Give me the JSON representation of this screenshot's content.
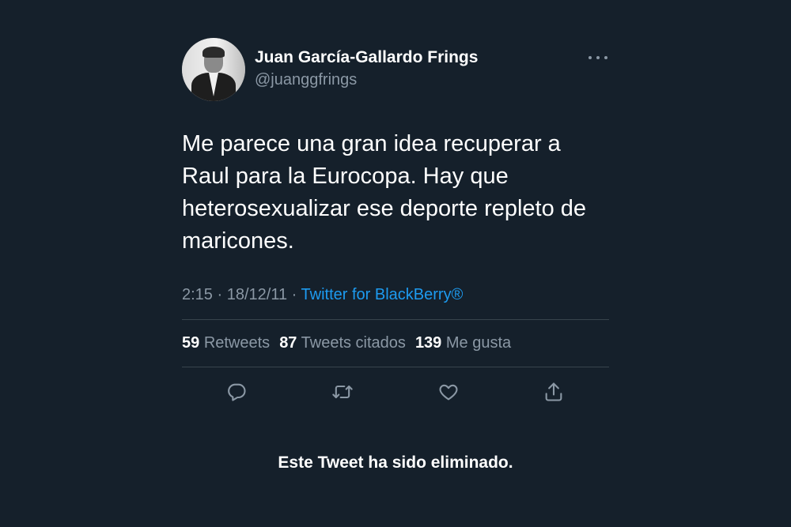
{
  "tweet": {
    "author": {
      "display_name": "Juan García-Gallardo Frings",
      "handle": "@juanggfrings"
    },
    "text": "Me parece una gran idea recuperar a Raul para la Eurocopa. Hay que heterosexualizar ese deporte repleto de maricones.",
    "time": "2:15",
    "separator": "·",
    "date": "18/12/11",
    "source": "Twitter for BlackBerry®",
    "stats": [
      {
        "count": "59",
        "label": "Retweets"
      },
      {
        "count": "87",
        "label": "Tweets citados"
      },
      {
        "count": "139",
        "label": "Me gusta"
      }
    ],
    "icons": {
      "more": "more-horizontal-icon",
      "reply": "reply-icon",
      "retweet": "retweet-icon",
      "like": "heart-icon",
      "share": "share-icon"
    }
  },
  "footer": {
    "message": "Este Tweet ha sido eliminado."
  },
  "colors": {
    "background": "#15202b",
    "accent": "#1d9bf0",
    "secondary_text": "#8b98a5"
  }
}
